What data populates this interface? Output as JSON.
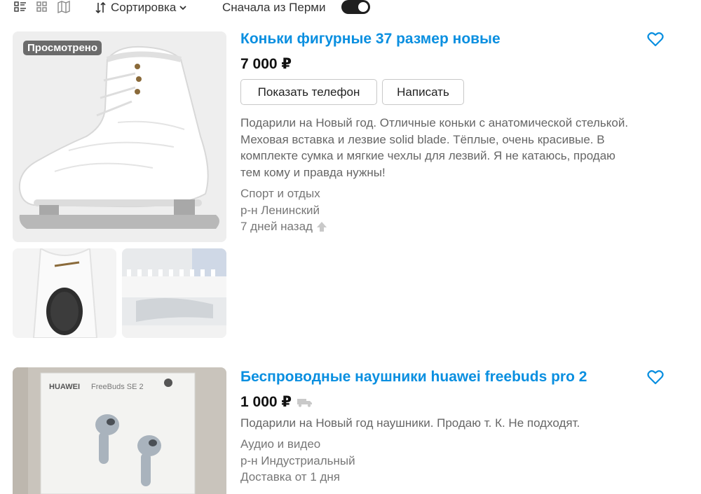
{
  "toolbar": {
    "view_icons": [
      "list-view-icon",
      "grid-view-icon",
      "map-view-icon"
    ],
    "sort_label": "Сортировка",
    "perm_first_label": "Сначала из Перми",
    "perm_first_enabled": true
  },
  "listings": [
    {
      "title": "Коньки фигурные 37 размер новые",
      "price": "7 000 ₽",
      "badge": "Просмотрено",
      "show_phone_label": "Показать телефон",
      "write_label": "Написать",
      "description": "Подарили на Новый год. Отличные коньки с анатомической стелькой. Меховая вставка и лезвие solid blade. Тёплые, очень красивые. В комплекте сумка и мягкие чехлы для лезвий. Я не катаюсь, продаю тем кому и правда нужны!",
      "category": "Спорт и отдых",
      "district": "р-н Ленинский",
      "date": "7 дней назад",
      "images": [
        "white-figure-skate-photo",
        "skate-inside-photo",
        "skate-blade-covers-photo"
      ]
    },
    {
      "title": "Беспроводные наушники huawei freebuds pro 2",
      "price": "1 000 ₽",
      "description": "Подарили на Новый год наушники. Продаю т. К. Не подходят.",
      "category": "Аудио и видео",
      "district": "р-н Индустриальный",
      "delivery": "Доставка от 1 дня",
      "box_brand": "HUAWEI",
      "box_model": "FreeBuds SE 2",
      "images": [
        "huawei-freebuds-box-photo"
      ]
    }
  ],
  "colors": {
    "title": "#0a8fe0",
    "text_muted": "#666666",
    "toggle_on": "#1f1f1f"
  }
}
